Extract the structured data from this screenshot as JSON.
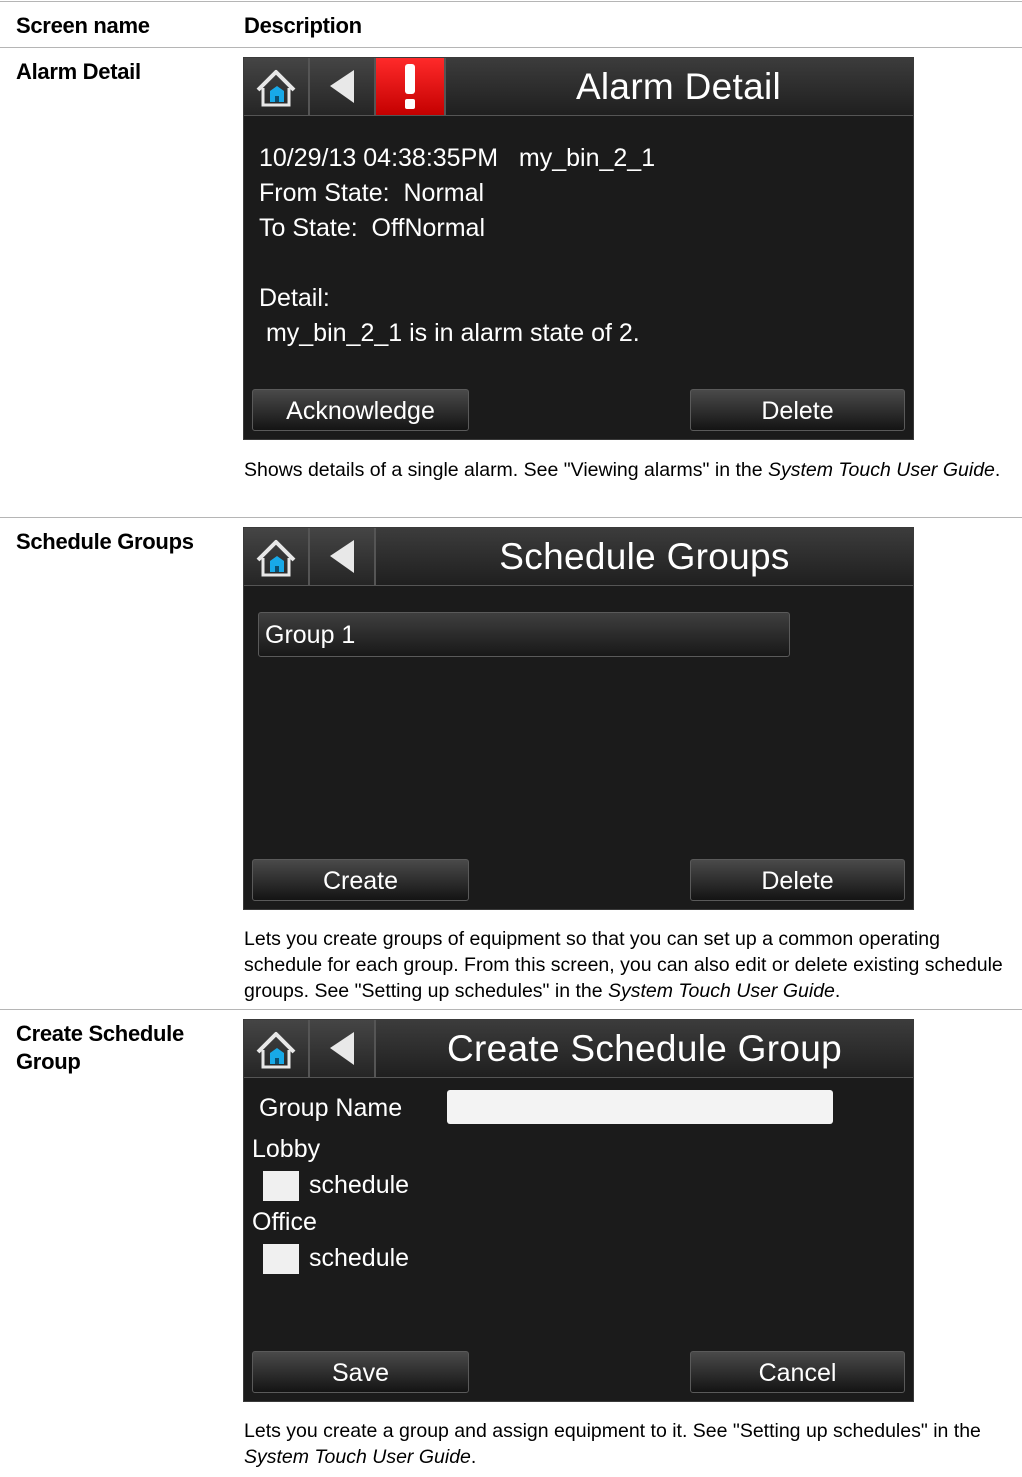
{
  "table": {
    "headers": {
      "screen_name": "Screen name",
      "description": "Description"
    }
  },
  "rows": [
    {
      "name": "Alarm Detail",
      "screen": {
        "title": "Alarm Detail",
        "lines": [
          "10/29/13 04:38:35PM   my_bin_2_1",
          "From State:  Normal",
          "To State:  OffNormal",
          "",
          "Detail:",
          " my_bin_2_1 is in alarm state of 2."
        ],
        "buttons": [
          "Acknowledge",
          "Delete"
        ]
      },
      "desc_before": "Shows details of a single alarm. See \"Viewing alarms\" in the ",
      "desc_italic": "System Touch User Guide",
      "desc_after": "."
    },
    {
      "name": "Schedule Groups",
      "screen": {
        "title": "Schedule Groups",
        "list": [
          "Group 1"
        ],
        "buttons": [
          "Create",
          "Delete"
        ]
      },
      "desc_before": "Lets you create groups of equipment so that you can set up a common operating schedule for each group. From this screen, you can also edit or delete existing schedule groups. See \"Setting up schedules\" in the ",
      "desc_italic": "System Touch User Guide",
      "desc_after": "."
    },
    {
      "name": "Create Schedule Group",
      "screen": {
        "title": "Create Schedule Group",
        "group_name_label": "Group Name",
        "group_name_value": "",
        "sections": [
          {
            "label": "Lobby",
            "item": "schedule",
            "checked": false
          },
          {
            "label": "Office",
            "item": "schedule",
            "checked": false
          }
        ],
        "buttons": [
          "Save",
          "Cancel"
        ]
      },
      "desc_before": "Lets you create a group and assign equipment to it. See \"Setting up schedules\" in the ",
      "desc_italic": "System Touch User Guide",
      "desc_after": "."
    }
  ],
  "icons": {
    "home": "home-icon",
    "back": "back-arrow-icon",
    "alarm": "alarm-exclamation-icon"
  },
  "colors": {
    "screen_bg": "#1b1b1b",
    "alarm_red": "#e00000",
    "home_blue": "#18a9e8"
  }
}
